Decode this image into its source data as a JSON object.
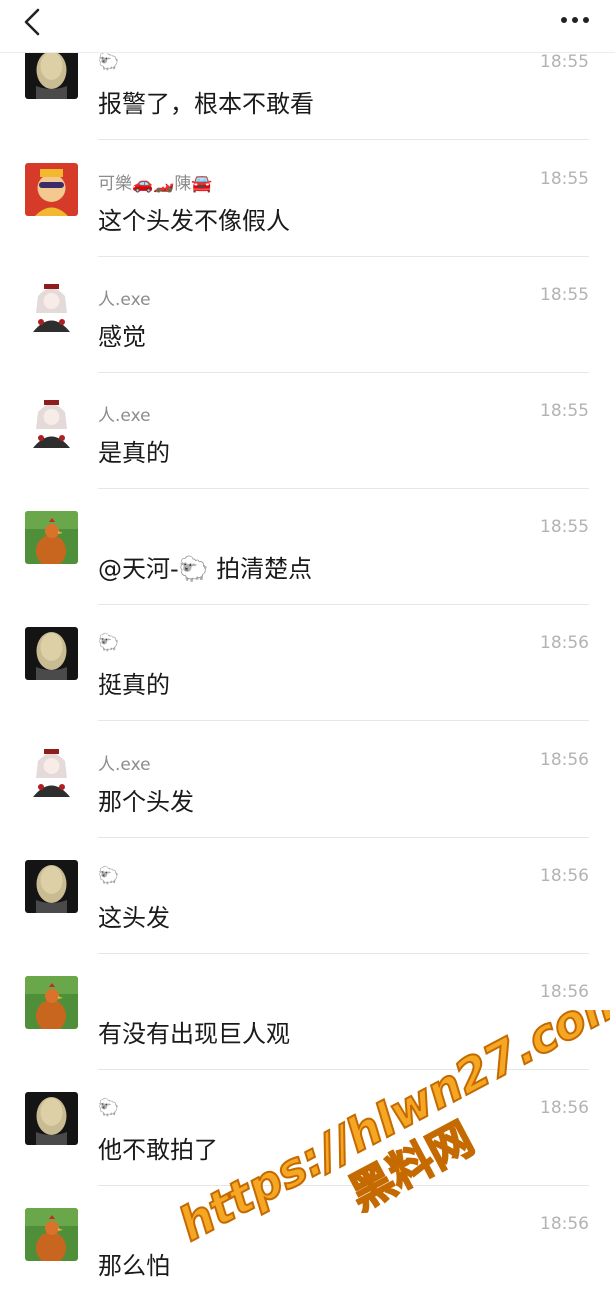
{
  "header": {
    "back_icon": "chevron-left-icon",
    "more_icon": "ellipsis-icon"
  },
  "colors": {
    "background": "#ffffff",
    "name_text": "#8c8c8c",
    "time_text": "#b3b3b3",
    "message_text": "#1a1a1a",
    "watermark": "#f5a623"
  },
  "messages": [
    {
      "avatar": "wig-avatar",
      "name": "🐑",
      "time": "18:55",
      "text": "报警了，根本不敢看"
    },
    {
      "avatar": "cartoon-red-avatar",
      "name": "可樂🚗🏎️陳🚘",
      "time": "18:55",
      "text": "这个头发不像假人"
    },
    {
      "avatar": "anime-girl-avatar",
      "name": "人.exe",
      "time": "18:55",
      "text": "感觉"
    },
    {
      "avatar": "anime-girl-avatar",
      "name": "人.exe",
      "time": "18:55",
      "text": "是真的"
    },
    {
      "avatar": "chicken-avatar",
      "name": "",
      "time": "18:55",
      "text": "@天河-🐑 拍清楚点"
    },
    {
      "avatar": "wig-avatar",
      "name": "🐑",
      "time": "18:56",
      "text": "挺真的"
    },
    {
      "avatar": "anime-girl-avatar",
      "name": "人.exe",
      "time": "18:56",
      "text": "那个头发"
    },
    {
      "avatar": "wig-avatar",
      "name": "🐑",
      "time": "18:56",
      "text": "这头发"
    },
    {
      "avatar": "chicken-avatar",
      "name": "",
      "time": "18:56",
      "text": "有没有出现巨人观"
    },
    {
      "avatar": "wig-avatar",
      "name": "🐑",
      "time": "18:56",
      "text": "他不敢拍了"
    },
    {
      "avatar": "chicken-avatar",
      "name": "",
      "time": "18:56",
      "text": "那么怕"
    }
  ],
  "watermark": {
    "url": "https://hlwn27.com",
    "label": "黑料网"
  }
}
